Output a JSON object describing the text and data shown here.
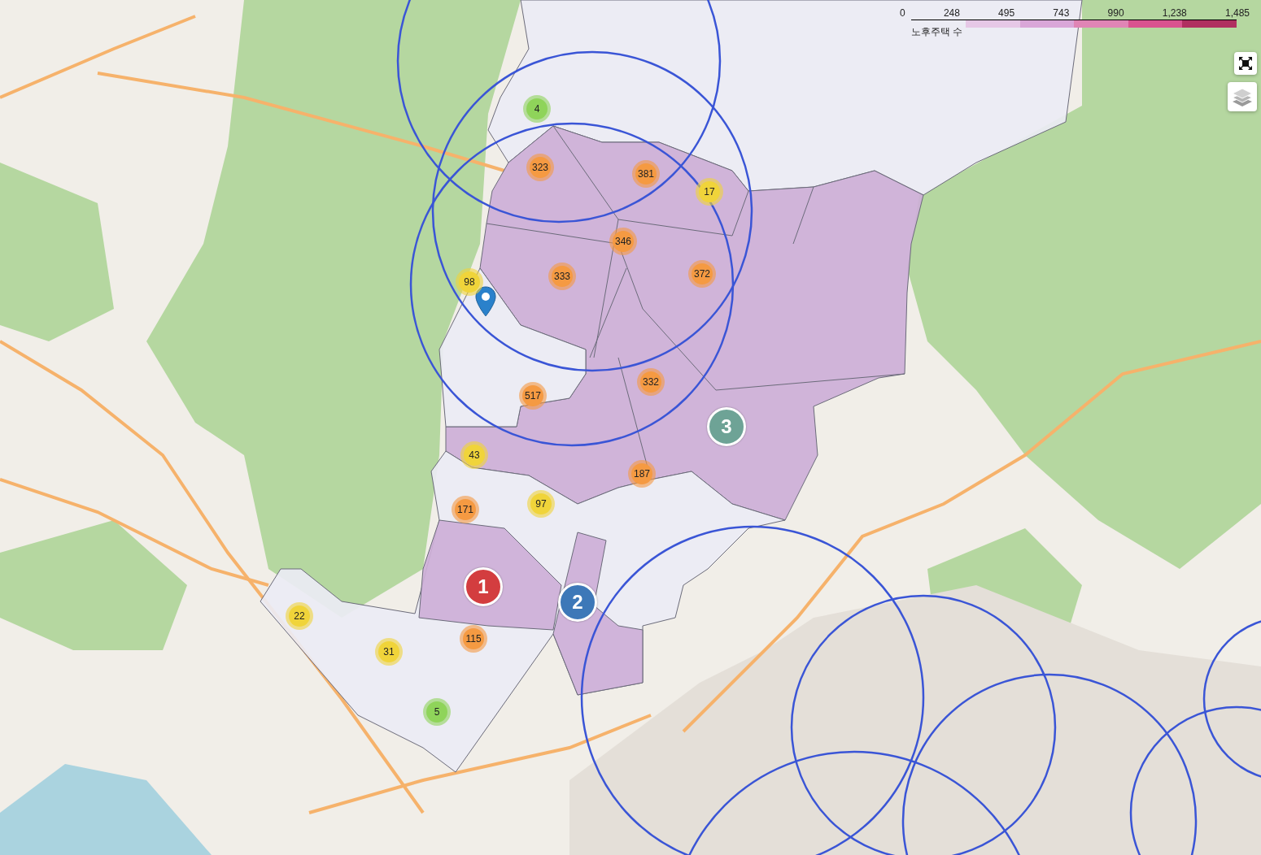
{
  "legend": {
    "title": "노후주택 수",
    "ticks": [
      "0",
      "248",
      "495",
      "743",
      "990",
      "1,238",
      "1,485"
    ],
    "bins": [
      {
        "color": "#e6c8e6"
      },
      {
        "color": "#d9a6d8"
      },
      {
        "color": "#e085b5"
      },
      {
        "color": "#d9538f"
      },
      {
        "color": "#b03060"
      }
    ]
  },
  "clusters": [
    {
      "count": "4",
      "color": "#8fd45a"
    },
    {
      "count": "323",
      "color": "#f59a42"
    },
    {
      "count": "381",
      "color": "#f59a42"
    },
    {
      "count": "17",
      "color": "#f0d43a"
    },
    {
      "count": "346",
      "color": "#f59a42"
    },
    {
      "count": "333",
      "color": "#f59a42"
    },
    {
      "count": "372",
      "color": "#f59a42"
    },
    {
      "count": "98",
      "color": "#f0d43a"
    },
    {
      "count": "332",
      "color": "#f59a42"
    },
    {
      "count": "517",
      "color": "#f59a42"
    },
    {
      "count": "43",
      "color": "#f0d43a"
    },
    {
      "count": "187",
      "color": "#f59a42"
    },
    {
      "count": "171",
      "color": "#f59a42"
    },
    {
      "count": "97",
      "color": "#f0d43a"
    },
    {
      "count": "22",
      "color": "#f0d43a"
    },
    {
      "count": "115",
      "color": "#f59a42"
    },
    {
      "count": "31",
      "color": "#f0d43a"
    },
    {
      "count": "5",
      "color": "#8fd45a"
    }
  ],
  "ranked_markers": [
    {
      "label": "1",
      "color": "#d33d3f"
    },
    {
      "label": "2",
      "color": "#3d78b8"
    },
    {
      "label": "3",
      "color": "#6ea396"
    }
  ]
}
